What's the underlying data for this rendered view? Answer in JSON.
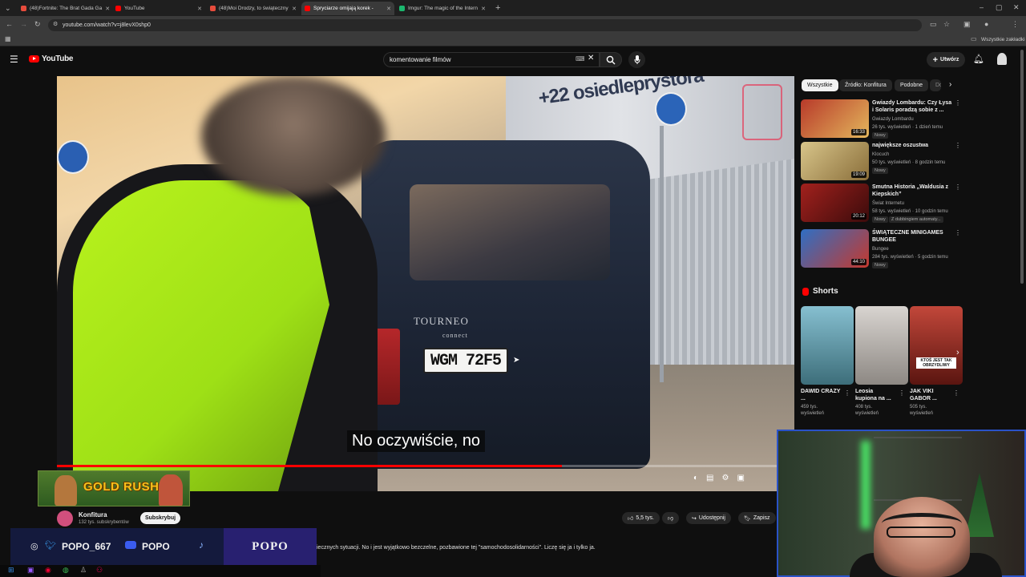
{
  "browser": {
    "tabs": [
      {
        "label": "(48)Fortnite: The Brat Gada Ga",
        "color": "#e74c3c"
      },
      {
        "label": "YouTube",
        "color": "#ff0000"
      },
      {
        "label": "(48)Moi Drodzy, to świąteczny",
        "color": "#e74c3c"
      },
      {
        "label": "Spryciarze omijają korek - ",
        "color": "#ff0000"
      },
      {
        "label": "Imgur: The magic of the Intern",
        "color": "#1bb76e"
      }
    ],
    "url": "youtube.com/watch?v=j8levX0shp0",
    "bookmarks_label": "Wszystkie zakładki"
  },
  "youtube": {
    "logo_text": "YouTube",
    "search_value": "komentowanie filmów",
    "create_label": "Utwórz"
  },
  "video": {
    "plate": "WGM 72F5",
    "van_badge": "TOURNEO",
    "van_badge_sub": "connect",
    "sign_text": "+22 osiedleprystora",
    "subtitle": "No oczywiście, no",
    "progress": 0.7
  },
  "channel": {
    "name": "Konfitura",
    "subs": "132 tys. subskrybentów",
    "subscribe_label": "Subskrybuj",
    "likes": "5,5 tys.",
    "share_label": "Udostępnij",
    "save_label": "Zapisz",
    "description": "iecznych sytuacji. No i jest wyjątkowo bezczelne, pozbawione tej \"samochodosolidarności\". Liczę się ja i tylko ja."
  },
  "overlay": {
    "gold_rush": "GOLD RUSH",
    "social_handle": "POPO_667",
    "yt_handle": "POPO",
    "brand": "POPO"
  },
  "sidebar": {
    "chips": [
      "Wszystkie",
      "Źródło: Konfitura",
      "Podobne",
      "Do"
    ],
    "recommendations": [
      {
        "title": "Gwiazdy Lombardu: Czy Łysa i Solaris poradzą sobie z ...",
        "channel": "Gwiazdy Lombardu",
        "meta": "26 tys. wyświetleń · 1 dzień temu",
        "badge": "Nowy",
        "duration": "16:33",
        "thumb_color": "#b83a2a"
      },
      {
        "title": "największe oszustwa",
        "channel": "Klocuch",
        "meta": "50 tys. wyświetleń · 8 godzin temu",
        "badge": "Nowy",
        "duration": "19:09",
        "thumb_color": "#d8c58a"
      },
      {
        "title": "Smutna Historia „Waldusia z Kiepskich”",
        "channel": "Świat Internetu",
        "meta": "58 tys. wyświetleń · 10 godzin temu",
        "badge": "Nowy",
        "badge2": "Z dubbingiem automaty...",
        "duration": "20:12",
        "thumb_color": "#a2211d"
      },
      {
        "title": "ŚWIĄTECZNE MINIGAMES BUNGEE",
        "channel": "Bungee",
        "meta": "284 tys. wyświetleń · 5 godzin temu",
        "badge": "Nowy",
        "duration": "44:10",
        "thumb_color": "#2f6fc4"
      }
    ],
    "shorts_label": "Shorts",
    "shorts": [
      {
        "title": "DAWID CRAZY ...",
        "views": "459 tys.",
        "views_label": "wyświetleń",
        "color": "#6fa7b8"
      },
      {
        "title": "Leosia kupiona na ...",
        "views": "408 tys.",
        "views_label": "wyświetleń",
        "color": "#c8c4c0"
      },
      {
        "title": "JAK VIKI GABOR ...",
        "views": "505 tys.",
        "views_label": "wyświetleń",
        "color": "#b33a2e",
        "overlay": "KTOŚ JEST TAK OBRZYDLIWY"
      }
    ]
  }
}
